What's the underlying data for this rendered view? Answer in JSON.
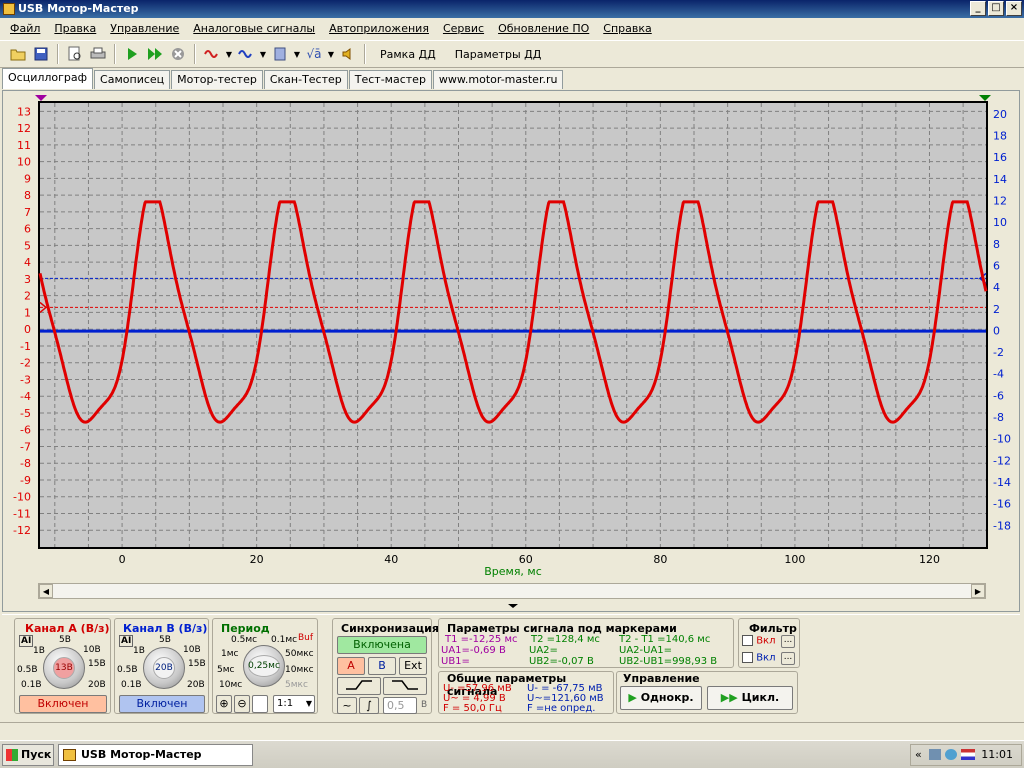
{
  "app": {
    "title": "USB Мотор-Мастер"
  },
  "window_buttons": {
    "minimize": "_",
    "maximize": "□",
    "close": "×"
  },
  "menu": [
    "Файл",
    "Правка",
    "Управление",
    "Аналоговые сигналы",
    "Автоприложения",
    "Сервис",
    "Обновление ПО",
    "Справка"
  ],
  "toolbar": {
    "icons": [
      "open-folder-icon",
      "save-icon",
      "print-preview-icon",
      "print-icon",
      "play-icon",
      "fast-forward-icon",
      "stop-icon",
      "signal-icon",
      "wave-icon",
      "calculator-icon",
      "sqrt-icon",
      "speaker-icon"
    ],
    "frame_button": "Рамка ДД",
    "params_button": "Параметры ДД"
  },
  "tabs": [
    "Осциллограф",
    "Самописец",
    "Мотор-тестер",
    "Скан-Тестер",
    "Тест-мастер",
    "www.motor-master.ru"
  ],
  "chart_data": {
    "type": "line",
    "xlabel": "Время, мс",
    "xlim": [
      -12.2,
      128.4
    ],
    "x_ticks": [
      0,
      20,
      40,
      60,
      80,
      100,
      120
    ],
    "ylim_left": [
      -13,
      13.5
    ],
    "y_ticks_left": [
      13,
      12,
      11,
      10,
      9,
      8,
      7,
      6,
      5,
      4,
      3,
      2,
      1,
      0,
      -1,
      -2,
      -3,
      -4,
      -5,
      -6,
      -7,
      -8,
      -9,
      -10,
      -11,
      -12
    ],
    "ylim_right": [
      -20,
      21
    ],
    "y_ticks_right": [
      20,
      18,
      16,
      14,
      12,
      10,
      8,
      6,
      4,
      2,
      0,
      -2,
      -4,
      -6,
      -8,
      -10,
      -12,
      -14,
      -16,
      -18
    ],
    "grid": true,
    "series": [
      {
        "name": "Канал A",
        "color": "#e00000",
        "axis": "left",
        "period_ms": 20.0,
        "min": -7.3,
        "max": 7.6,
        "first_peak_ms": 5.1
      },
      {
        "name": "Канал B",
        "color": "#0020d0",
        "axis": "right",
        "level": -0.07
      }
    ],
    "markers": {
      "a_level": 1.3,
      "b_level": 4.8
    }
  },
  "channel_a": {
    "title": "Канал А (В/з)",
    "mode": "AI",
    "labels": [
      "5В",
      "1В",
      "10В",
      "0.5В",
      "15В",
      "0.1В",
      "20В"
    ],
    "value": "13В",
    "button": "Включен"
  },
  "channel_b": {
    "title": "Канал В (В/з)",
    "mode": "AI",
    "labels": [
      "5В",
      "1В",
      "10В",
      "0.5В",
      "15В",
      "0.1В",
      "20В"
    ],
    "value": "20В",
    "button": "Включен"
  },
  "period": {
    "title": "Период",
    "buf": "Buf",
    "labels": [
      "0.5мс",
      "0.1мс",
      "1мс",
      "50мкс",
      "5мс",
      "10мкс",
      "10мс",
      "5мкс"
    ],
    "value": "0,25мс",
    "ratio": "1:1"
  },
  "sync": {
    "title": "Синхронизация",
    "enabled": "Включена",
    "a": "А",
    "b": "В",
    "ext": "Ext",
    "level": "0,5",
    "unit": "В"
  },
  "markers_params": {
    "title": "Параметры сигнала под маркерами",
    "t1": "T1 =-12,25 мс",
    "t2": "T2 =128,4 мс",
    "dt": "T2 - T1 =140,6 мс",
    "ua1": "UA1=-0,69 В",
    "ua2": "UA2=",
    "dua": "UA2-UA1=",
    "ub1": "UB1=",
    "ub2": "UB2=-0,07 В",
    "dub": "UB2-UB1=998,93 В"
  },
  "general_params": {
    "title": "Общие параметры сигнала",
    "a_dc": "U- =57,96 мВ",
    "a_ac": "U~ = 4,99 В",
    "a_f": "F = 50,0 Гц",
    "b_dc": "U- = -67,75 мВ",
    "b_ac": "U~=121,60 мВ",
    "b_f": "F =не опред."
  },
  "filter": {
    "title": "Фильтр",
    "label1": "Вкл",
    "label2": "Вкл",
    "more": "..."
  },
  "control": {
    "title": "Управление",
    "single": "Однокр.",
    "cycle": "Цикл."
  },
  "taskbar": {
    "start": "Пуск",
    "app": "USB Мотор-Мастер",
    "clock": "11:01",
    "collapse": "«"
  }
}
